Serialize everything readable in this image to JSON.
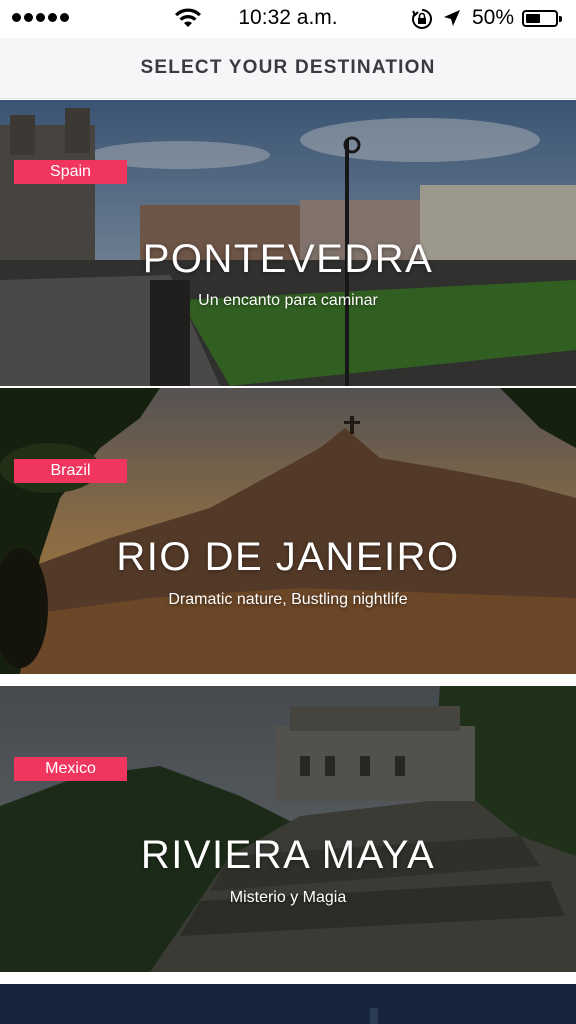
{
  "status_bar": {
    "time": "10:32 a.m.",
    "battery_percent": "50%",
    "battery_level": 0.5,
    "signal_bars": 5
  },
  "header": {
    "title": "SELECT YOUR DESTINATION"
  },
  "destinations": [
    {
      "country": "Spain",
      "name": "PONTEVEDRA",
      "tagline": "Un encanto para caminar"
    },
    {
      "country": "Brazil",
      "name": "RIO DE JANEIRO",
      "tagline": "Dramatic nature, Bustling nightlife"
    },
    {
      "country": "Mexico",
      "name": "RIVIERA MAYA",
      "tagline": "Misterio y Magia"
    }
  ],
  "colors": {
    "tag_accent": "#f0365f",
    "header_bg": "#f5f6f8",
    "header_text": "#3b3b3f"
  }
}
